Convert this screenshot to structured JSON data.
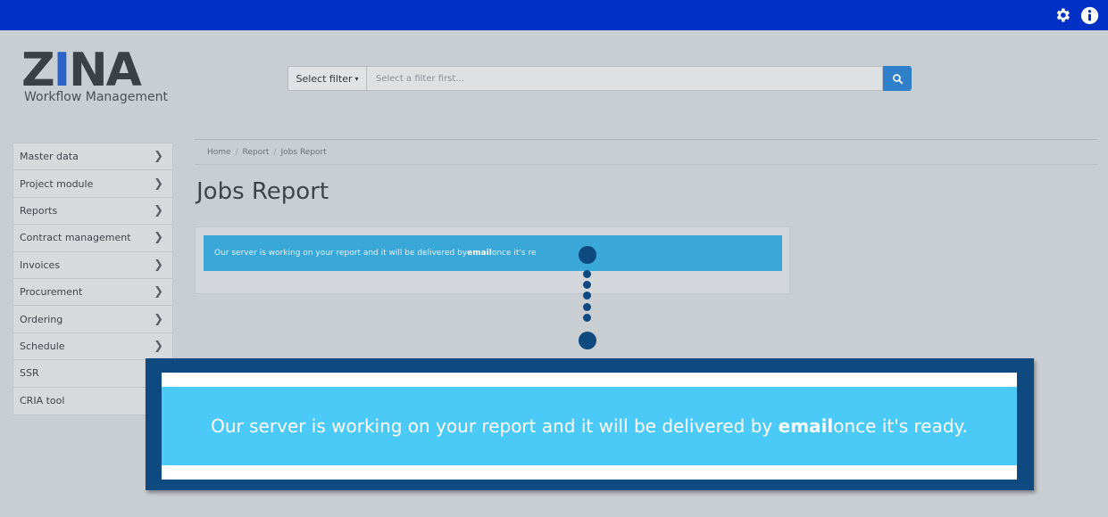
{
  "header": {
    "settings_icon": "gear-icon",
    "info_icon": "info-circle-icon",
    "bar_color": "#0031c4"
  },
  "logo": {
    "wordmark_dark_start": "Z",
    "wordmark_accent": "I",
    "wordmark_dark_end": "NA",
    "subtitle": "Workflow Management"
  },
  "search": {
    "filter_label": "Select filter",
    "placeholder": "Select a filter first...",
    "button_icon": "search-icon"
  },
  "sidebar": {
    "items": [
      {
        "label": "Master data",
        "has_chevron": true
      },
      {
        "label": "Project module",
        "has_chevron": true
      },
      {
        "label": "Reports",
        "has_chevron": true
      },
      {
        "label": "Contract management",
        "has_chevron": true
      },
      {
        "label": "Invoices",
        "has_chevron": true
      },
      {
        "label": "Procurement",
        "has_chevron": true
      },
      {
        "label": "Ordering",
        "has_chevron": true
      },
      {
        "label": "Schedule",
        "has_chevron": true
      },
      {
        "label": "SSR",
        "has_chevron": false
      },
      {
        "label": "CRIA tool",
        "has_chevron": false
      }
    ]
  },
  "breadcrumb": {
    "home": "Home",
    "report": "Report",
    "current": "Jobs Report"
  },
  "main": {
    "title": "Jobs Report",
    "alert": {
      "text_before": "Our server is working on your report and it will be delivered by ",
      "bold": "email",
      "text_after": " once it's re"
    }
  },
  "callout": {
    "text_before": "Our server is working on your report and it will be delivered by ",
    "bold": "email",
    "text_after": " once it's ready.",
    "border_color": "#0e4a80",
    "band_color": "#4ccaf7"
  }
}
